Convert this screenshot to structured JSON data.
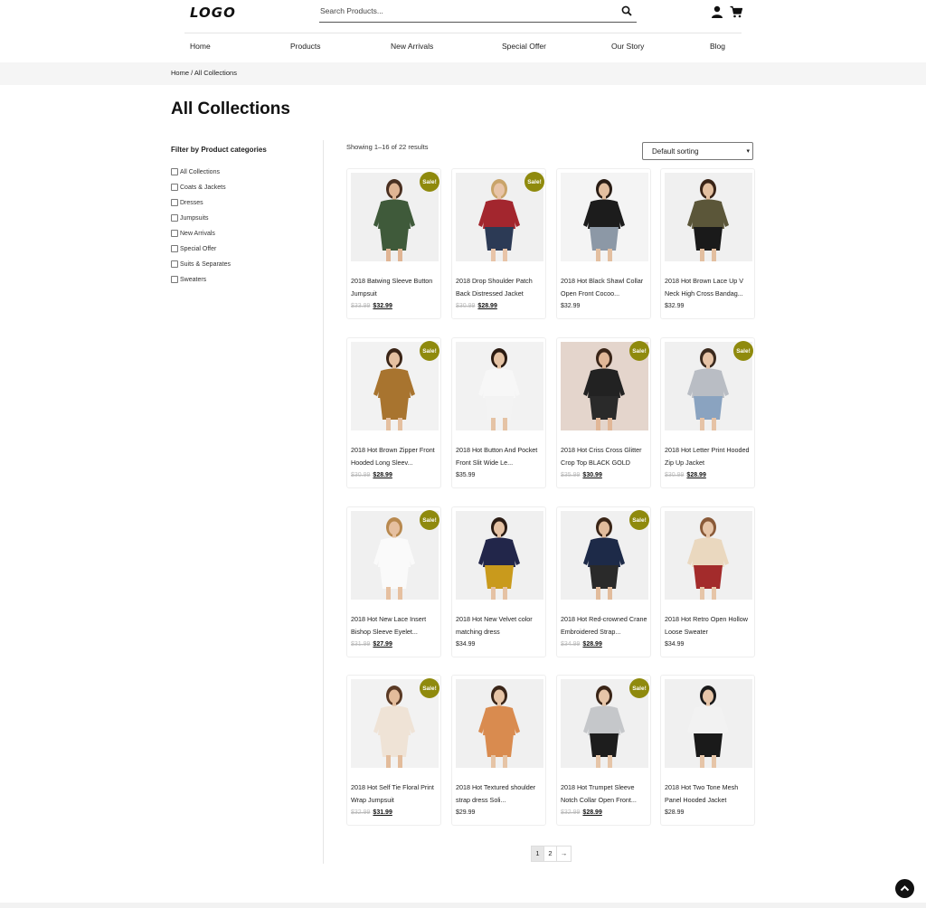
{
  "header": {
    "logo": "LOGO",
    "search_placeholder": "Search Products...",
    "icons": [
      "search-icon",
      "user-icon",
      "cart-icon"
    ]
  },
  "nav": [
    "Home",
    "Products",
    "New Arrivals",
    "Special Offer",
    "Our Story",
    "Blog"
  ],
  "breadcrumb": "Home / All Collections",
  "page_title": "All Collections",
  "filter": {
    "heading": "Filter by Product categories",
    "categories": [
      "All Collections",
      "Coats & Jackets",
      "Dresses",
      "Jumpsuits",
      "New Arrivals",
      "Special Offer",
      "Suits & Separates",
      "Sweaters"
    ]
  },
  "results_text": "Showing 1–16 of 22 results",
  "sort_selected": "Default sorting",
  "sale_badge": "Sale!",
  "products": [
    {
      "name": "2018 Batwing Sleeve Button Jumpsuit",
      "old": "$33.99",
      "price": "$32.99",
      "sale": true,
      "bg": "#f0f0f0",
      "top": "#3f5a3a",
      "bottom": "#3f5a3a",
      "skin": "#e0b594",
      "hair": "#4a3021"
    },
    {
      "name": "2018 Drop Shoulder Patch Back Distressed Jacket",
      "old": "$30.99",
      "price": "$28.99",
      "sale": true,
      "bg": "#f0f0f0",
      "top": "#a3262e",
      "bottom": "#2c3a55",
      "skin": "#e8c4a8",
      "hair": "#c9a46a"
    },
    {
      "name": "2018 Hot Black Shawl Collar Open Front Cocoo...",
      "old": "",
      "price": "$32.99",
      "sale": false,
      "bg": "#f4f4f4",
      "top": "#1c1c1c",
      "bottom": "#8c98a6",
      "skin": "#e3bfa0",
      "hair": "#2a1d15"
    },
    {
      "name": "2018 Hot Brown Lace Up V Neck High Cross Bandag...",
      "old": "",
      "price": "$32.99",
      "sale": false,
      "bg": "#f0f0f0",
      "top": "#5b5639",
      "bottom": "#1a1a1a",
      "skin": "#e3bfa0",
      "hair": "#3a2417"
    },
    {
      "name": "2018 Hot Brown Zipper Front Hooded Long Sleev...",
      "old": "$30.99",
      "price": "$28.99",
      "sale": true,
      "bg": "#f2f2f2",
      "top": "#a8742f",
      "bottom": "#a8742f",
      "skin": "#e5c0a0",
      "hair": "#3b2517"
    },
    {
      "name": "2018 Hot Button And Pocket Front Slit Wide Le...",
      "old": "",
      "price": "$35.99",
      "sale": false,
      "bg": "#f2f2f2",
      "top": "#f7f7f7",
      "bottom": "#f3f3f3",
      "skin": "#e5c3a5",
      "hair": "#2b1b12"
    },
    {
      "name": "2018 Hot Criss Cross Glitter Crop Top BLACK GOLD",
      "old": "$35.99",
      "price": "$30.99",
      "sale": true,
      "bg": "#e4d5cc",
      "top": "#222222",
      "bottom": "#2a2a2a",
      "skin": "#e1b797",
      "hair": "#3a2518"
    },
    {
      "name": "2018 Hot Letter Print Hooded Zip Up Jacket",
      "old": "$30.99",
      "price": "$28.99",
      "sale": true,
      "bg": "#f0f0f0",
      "top": "#b9bdc4",
      "bottom": "#8aa3c0",
      "skin": "#e6c3a6",
      "hair": "#3b2a1e"
    },
    {
      "name": "2018 Hot New Lace Insert Bishop Sleeve Eyelet...",
      "old": "$31.99",
      "price": "$27.99",
      "sale": true,
      "bg": "#f0f0f0",
      "top": "#fafafa",
      "bottom": "#fafafa",
      "skin": "#e6c0a0",
      "hair": "#b8894f"
    },
    {
      "name": "2018 Hot New Velvet color matching dress",
      "old": "",
      "price": "$34.99",
      "sale": false,
      "bg": "#f0f0f0",
      "top": "#22264a",
      "bottom": "#c99a1c",
      "skin": "#e5c2a4",
      "hair": "#2b1c14"
    },
    {
      "name": "2018 Hot Red-crowned Crane Embroidered Strap...",
      "old": "$34.99",
      "price": "$28.99",
      "sale": true,
      "bg": "#f0f0f0",
      "top": "#1d2a48",
      "bottom": "#2a2a2a",
      "skin": "#e2bc9c",
      "hair": "#3a2517"
    },
    {
      "name": "2018 Hot Retro Open Hollow Loose Sweater",
      "old": "",
      "price": "$34.99",
      "sale": false,
      "bg": "#f0f0f0",
      "top": "#ead8bf",
      "bottom": "#a32b2b",
      "skin": "#e6c5a8",
      "hair": "#8a5a38"
    },
    {
      "name": "2018 Hot Self Tie Floral Print Wrap Jumpsuit",
      "old": "$32.99",
      "price": "$31.99",
      "sale": true,
      "bg": "#f2f2f2",
      "top": "#efe3d6",
      "bottom": "#efe3d6",
      "skin": "#e3bc9b",
      "hair": "#5a3a25"
    },
    {
      "name": "2018 Hot Textured shoulder strap dress Soli...",
      "old": "",
      "price": "$29.99",
      "sale": false,
      "bg": "#f0f0f0",
      "top": "#d98b4f",
      "bottom": "#d98b4f",
      "skin": "#e6c4a6",
      "hair": "#3a2518"
    },
    {
      "name": "2018 Hot Trumpet Sleeve Notch Collar Open Front...",
      "old": "$32.99",
      "price": "$28.99",
      "sale": true,
      "bg": "#f0f0f0",
      "top": "#c5c7ca",
      "bottom": "#1d1d1d",
      "skin": "#e6c5a8",
      "hair": "#3a2517"
    },
    {
      "name": "2018 Hot Two Tone Mesh Panel Hooded Jacket",
      "old": "",
      "price": "$28.99",
      "sale": false,
      "bg": "#f0f0f0",
      "top": "#f2f2f2",
      "bottom": "#1a1a1a",
      "skin": "#e6c5a8",
      "hair": "#1a1a1a"
    }
  ],
  "pagination": [
    "1",
    "2",
    "→"
  ],
  "accent_color": "#8f8a0d"
}
